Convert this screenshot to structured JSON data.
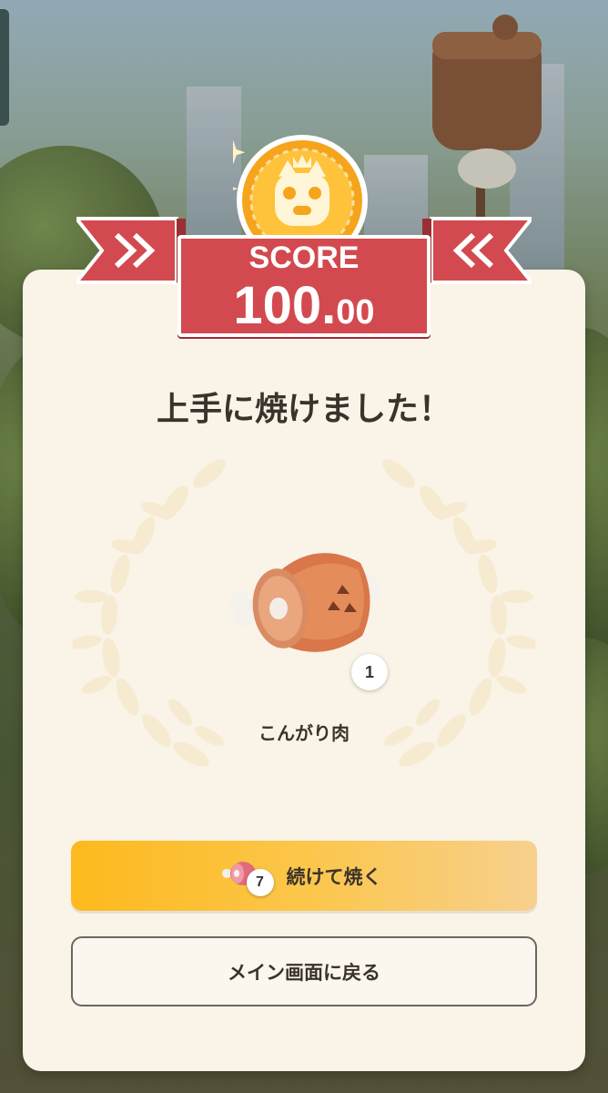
{
  "score": {
    "label": "SCORE",
    "integer_part": "100.",
    "decimal_part": "00"
  },
  "result": {
    "title": "上手に焼けました！"
  },
  "reward": {
    "item_name": "こんがり肉",
    "quantity": "1",
    "icon": "cooked-meat-icon"
  },
  "actions": {
    "continue": {
      "label": "続けて焼く",
      "remaining_raw_meat": "7",
      "icon": "raw-meat-icon"
    },
    "back": {
      "label": "メイン画面に戻る"
    }
  },
  "colors": {
    "banner_red": "#d24a4f",
    "card_bg": "#faf3e7",
    "continue_button": "#fdb91d",
    "coin_gold": "#f6a41c"
  }
}
